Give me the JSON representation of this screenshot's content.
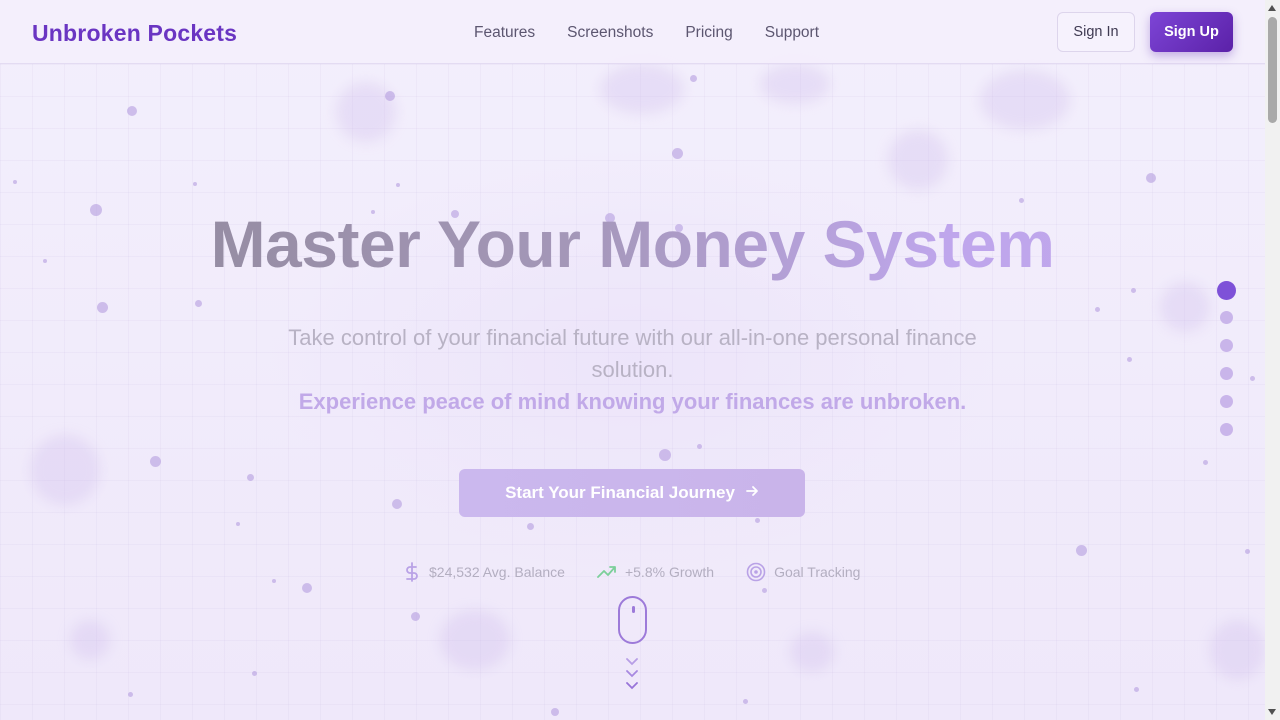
{
  "brand": {
    "name": "Unbroken Pockets"
  },
  "nav": {
    "items": [
      {
        "label": "Features"
      },
      {
        "label": "Screenshots"
      },
      {
        "label": "Pricing"
      },
      {
        "label": "Support"
      }
    ]
  },
  "auth": {
    "sign_in": "Sign In",
    "sign_up": "Sign Up"
  },
  "hero": {
    "title": "Master Your Money System",
    "subtitle": "Take control of your financial future with our all-in-one personal finance solution.",
    "tagline": "Experience peace of mind knowing your finances are unbroken.",
    "cta_label": "Start Your Financial Journey",
    "cta_icon": "arrow-right-icon"
  },
  "stats": [
    {
      "icon": "dollar-icon",
      "label": "$24,532 Avg. Balance"
    },
    {
      "icon": "trending-up-icon",
      "label": "+5.8% Growth"
    },
    {
      "icon": "target-icon",
      "label": "Goal Tracking"
    }
  ],
  "section_nav": {
    "count": 6,
    "active_index": 0
  },
  "colors": {
    "brand_purple": "#6a35c2",
    "button_gradient_start": "#7d45d6",
    "button_gradient_end": "#5b21a8",
    "growth_green": "#7ccf9a",
    "background": "#f1ecfb"
  }
}
